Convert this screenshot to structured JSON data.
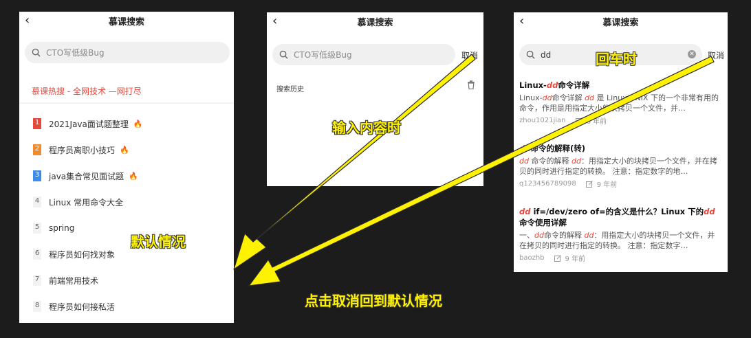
{
  "colors": {
    "accent": "#e8473b",
    "annotation": "#fff200",
    "background": "#1c1c1c"
  },
  "panel_default": {
    "title": "慕课搜索",
    "search_placeholder": "CTO写低级Bug",
    "hot_title": "慕课热搜 - 全网技术 —网打尽",
    "items": [
      {
        "rank": "1",
        "label": "2021Java面试题整理",
        "hot": true,
        "color": "#e8473b"
      },
      {
        "rank": "2",
        "label": "程序员离职小技巧",
        "hot": true,
        "color": "#f08c2e"
      },
      {
        "rank": "3",
        "label": "java集合常见面试题",
        "hot": true,
        "color": "#3b8de8"
      },
      {
        "rank": "4",
        "label": "Linux 常用命令大全",
        "hot": false
      },
      {
        "rank": "5",
        "label": "spring",
        "hot": false
      },
      {
        "rank": "6",
        "label": "程序员如何找对象",
        "hot": false
      },
      {
        "rank": "7",
        "label": "前端常用技术",
        "hot": false
      },
      {
        "rank": "8",
        "label": "程序员如何接私活",
        "hot": false
      }
    ]
  },
  "panel_input": {
    "title": "慕课搜索",
    "search_placeholder": "CTO写低级Bug",
    "cancel": "取消",
    "history_label": "搜索历史"
  },
  "panel_results": {
    "title": "慕课搜索",
    "search_value": "dd",
    "cancel": "取消",
    "results": [
      {
        "title": "Linux-dd命令详解",
        "snippet": "Linux-dd命令详解 dd 是 Linux/UNIX 下的一个非常有用的命令，作用是用指定大小的块拷贝一个文件，并…",
        "author": "zhou1021jian",
        "time": "6 年前"
      },
      {
        "title": "dd命令的解释(转)",
        "snippet": "dd 命令的解释 dd：用指定大小的块拷贝一个文件，并在拷贝的同时进行指定的转换。 注意：指定数字的地…",
        "author": "q123456789098",
        "time": "9 年前"
      },
      {
        "title": "dd if=/dev/zero of=的含义是什么？Linux 下的dd命令使用详解",
        "snippet": "一、dd命令的解释 dd：用指定大小的块拷贝一个文件，并在拷贝的同时进行指定的转换。 注意：指定数字…",
        "author": "baozhb",
        "time": "9 年前"
      }
    ]
  },
  "annotations": {
    "default_state": "默认情况",
    "typing_state": "输入内容时",
    "enter_state": "回车时",
    "cancel_back": "点击取消回到默认情况"
  }
}
